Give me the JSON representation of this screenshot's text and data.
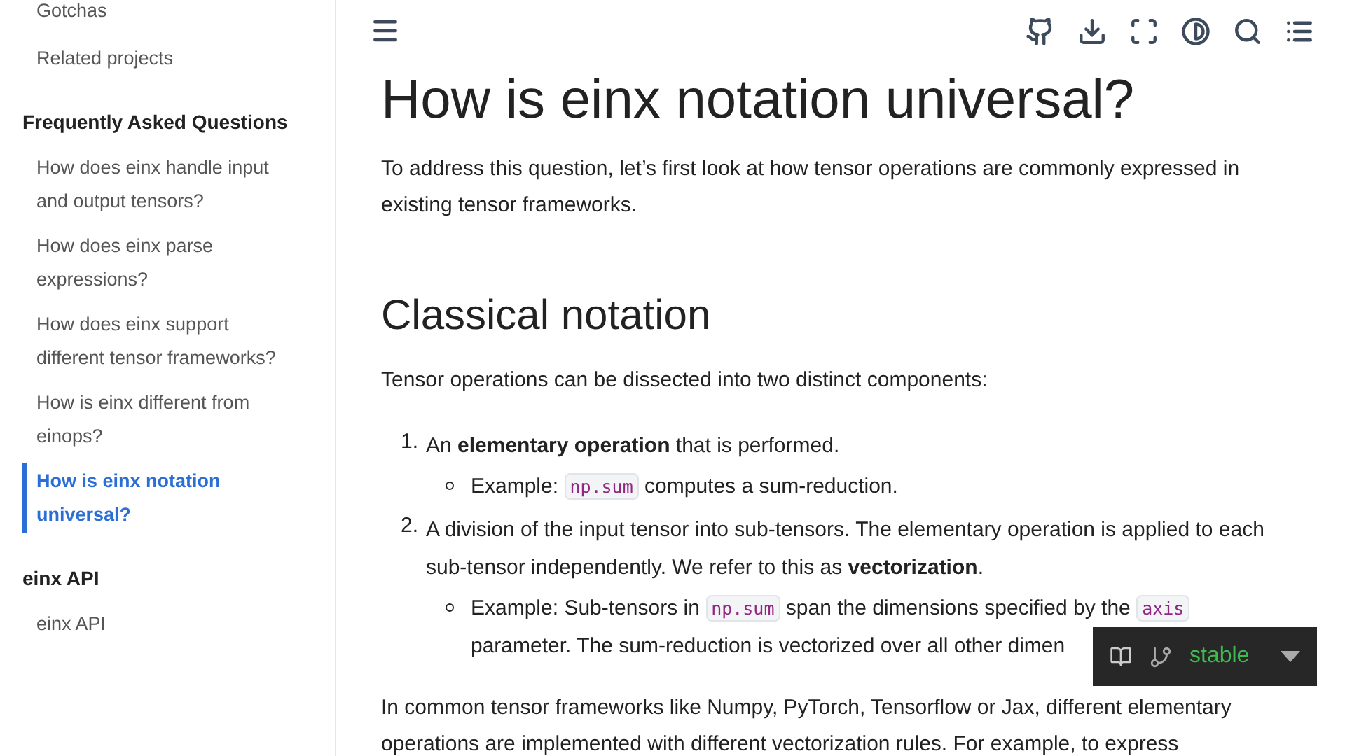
{
  "sidebar": {
    "items": [
      {
        "label": "Gotchas",
        "selected": false
      },
      {
        "label": "Related projects",
        "selected": false
      }
    ],
    "sections": [
      {
        "title": "Frequently Asked Questions",
        "items": [
          {
            "label": "How does einx handle input and output tensors?",
            "selected": false
          },
          {
            "label": "How does einx parse expressions?",
            "selected": false
          },
          {
            "label": "How does einx support different tensor frameworks?",
            "selected": false
          },
          {
            "label": "How is einx different from einops?",
            "selected": false
          },
          {
            "label": "How is einx notation universal?",
            "selected": true
          }
        ]
      },
      {
        "title": "einx API",
        "items": [
          {
            "label": "einx API",
            "selected": false
          }
        ]
      }
    ]
  },
  "article": {
    "title": "How is einx notation universal?",
    "intro": "To address this question, let’s first look at how tensor operations are commonly expressed in existing tensor frameworks.",
    "section_title": "Classical notation",
    "lead": "Tensor operations can be dissected into two distinct components:",
    "list": [
      {
        "number": "1.",
        "parts": [
          {
            "kind": "text",
            "text": "An **elementary operation** that is performed."
          }
        ],
        "sub": [
          {
            "kind": "text",
            "text": "Example: "
          },
          {
            "kind": "code",
            "text": "np.sum"
          },
          {
            "kind": "text",
            "text": " computes a sum-reduction."
          }
        ]
      },
      {
        "number": "2.",
        "parts": [
          {
            "kind": "text",
            "text": "A division of the input tensor into sub-tensors. The elementary operation is applied to each sub-tensor independently. We refer to this as **vectorization**."
          }
        ],
        "sub": [
          {
            "kind": "text",
            "text": "Example: Sub-tensors in "
          },
          {
            "kind": "code",
            "text": "np.sum"
          },
          {
            "kind": "text",
            "text": " span the dimensions specified by the "
          },
          {
            "kind": "code",
            "text": "axis"
          },
          {
            "kind": "text",
            "text": " parameter. The sum-reduction is vectorized over all other dimen"
          }
        ]
      }
    ],
    "outro": "In common tensor frameworks like Numpy, PyTorch, Tensorflow or Jax, different elementary operations are implemented with different vectorization rules. For example, to express"
  },
  "version_badge": {
    "version": "stable"
  }
}
